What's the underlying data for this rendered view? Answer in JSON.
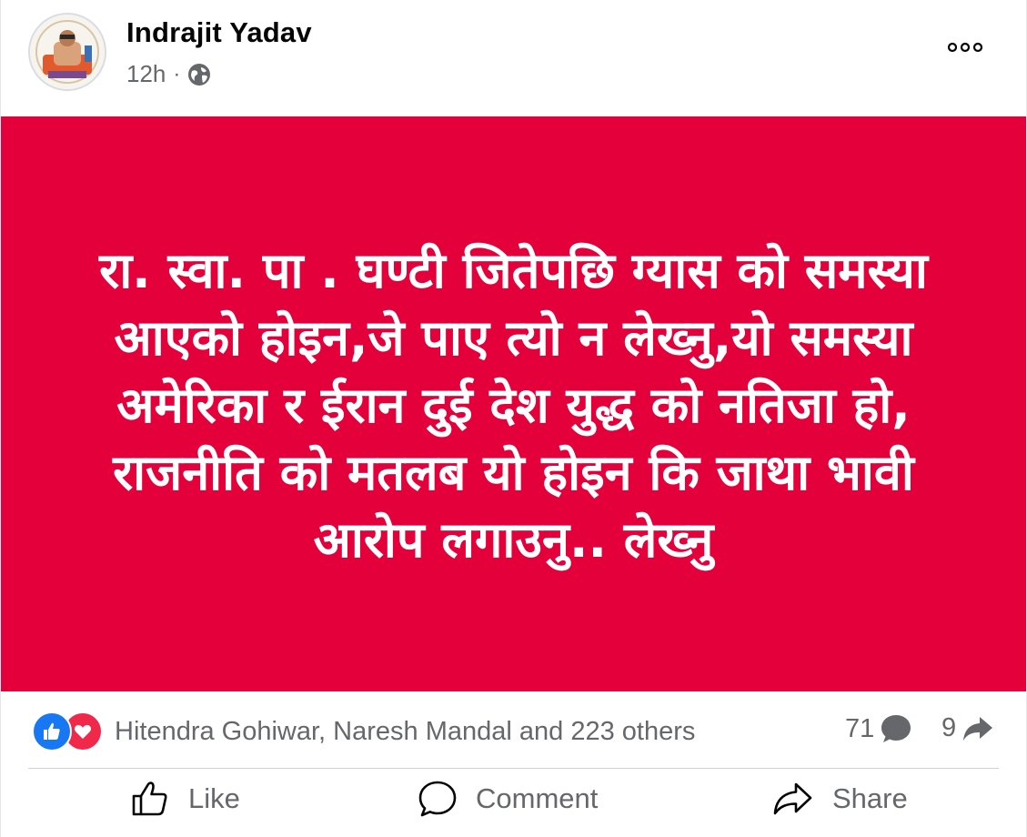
{
  "post": {
    "author": "Indrajit Yadav",
    "time": "12h",
    "separator": "·",
    "audience_icon": "globe-icon",
    "more_icon": "more-options-icon"
  },
  "card": {
    "background": "#e4003a",
    "lines": [
      "रा. स्वा. पा . घण्टी जितेपछि ग्यास को समस्या",
      "आएको होइन,जे पाए त्यो न लेख्नु,यो समस्या",
      "अमेरिका र ईरान दुई देश युद्ध को नतिजा हो,",
      "राजनीति को मतलब यो होइन कि जाथा भावी",
      "आरोप लगाउनु.. लेख्नु"
    ]
  },
  "reactions": {
    "icons": [
      "like-reaction-icon",
      "love-reaction-icon"
    ],
    "summary": "Hitendra Gohiwar, Naresh Mandal and 223 others",
    "comments_count": "71",
    "shares_count": "9"
  },
  "actions": {
    "like_label": "Like",
    "comment_label": "Comment",
    "share_label": "Share"
  },
  "colors": {
    "like_blue": "#1877f2",
    "love_red": "#f0284a",
    "secondary_text": "#65676b"
  }
}
